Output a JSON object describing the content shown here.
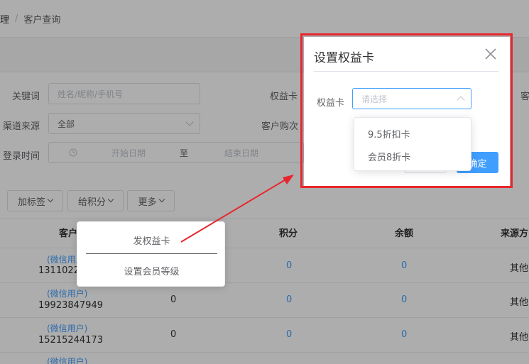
{
  "breadcrumb": {
    "parent": "理",
    "separator": "/",
    "current": "客户查询"
  },
  "filters": {
    "keyword_label": "关键词",
    "keyword_placeholder": "姓名/昵称/手机号",
    "card_label": "权益卡",
    "customer_label": "客",
    "channel_label": "渠道来源",
    "channel_value": "全部",
    "purchase_label": "客户购次",
    "login_label": "登录时间",
    "start_placeholder": "开始日期",
    "range_sep": "至",
    "end_placeholder": "结束日期"
  },
  "toolbar": {
    "tag_btn": "加标签",
    "points_btn": "给积分",
    "more_btn": "更多"
  },
  "table": {
    "headers": [
      "客户",
      "积分",
      "余额",
      "来源方"
    ],
    "rows": [
      {
        "nick": "(微信用户)",
        "phone": "1311022",
        "growth": "",
        "points": "0",
        "balance": "0",
        "source": "其他"
      },
      {
        "nick": "(微信用户)",
        "phone": "19923847949",
        "growth": "0",
        "points": "0",
        "balance": "0",
        "source": "其他"
      },
      {
        "nick": "(微信用户)",
        "phone": "15215244173",
        "growth": "0",
        "points": "0",
        "balance": "0",
        "source": "其他"
      },
      {
        "nick": "(微信用户)",
        "phone": "",
        "growth": "",
        "points": "",
        "balance": "",
        "source": ""
      }
    ]
  },
  "more_menu": {
    "items": [
      "发权益卡",
      "设置会员等级"
    ]
  },
  "dialog": {
    "title": "设置权益卡",
    "field_label": "权益卡",
    "select_placeholder": "请选择",
    "ok_label": "确 定",
    "ok_label_visible": "确定",
    "options": [
      "9.5折扣卡",
      "会员8折卡"
    ]
  },
  "colors": {
    "accent": "#409eff",
    "highlight": "#e8262d",
    "mask": "rgba(0,0,0,0.32)"
  }
}
